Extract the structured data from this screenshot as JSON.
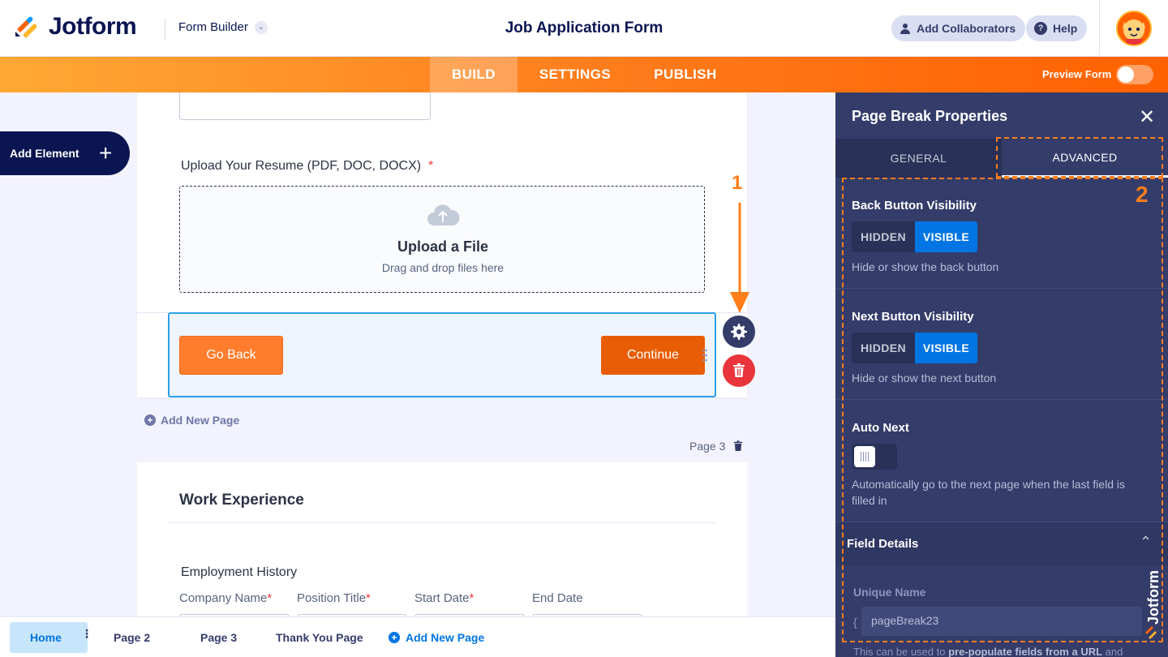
{
  "header": {
    "brand": "Jotform",
    "builder_label": "Form Builder",
    "form_title": "Job Application Form",
    "collaborators_label": "Add Collaborators",
    "help_label": "Help"
  },
  "nav": {
    "tabs": [
      "BUILD",
      "SETTINGS",
      "PUBLISH"
    ],
    "active": "BUILD",
    "preview_label": "Preview Form"
  },
  "sidebar": {
    "add_element_label": "Add Element"
  },
  "form": {
    "upload_field": {
      "label": "Upload Your Resume (PDF, DOC, DOCX)",
      "required_mark": "*",
      "title": "Upload a File",
      "subtitle": "Drag and drop files here"
    },
    "page_break": {
      "back_label": "Go Back",
      "continue_label": "Continue"
    },
    "add_new_page_label": "Add New Page",
    "page_label": "Page 3",
    "section_title": "Work Experience",
    "employment_label": "Employment History",
    "columns": [
      {
        "label": "Company Name",
        "required": "*"
      },
      {
        "label": "Position Title",
        "required": "*"
      },
      {
        "label": "Start Date",
        "required": "*"
      },
      {
        "label": "End Date",
        "required": ""
      }
    ]
  },
  "annotations": {
    "step1": "1",
    "step2": "2"
  },
  "pages_bar": {
    "tabs": [
      "Home",
      "Page 2",
      "Page 3",
      "Thank You Page"
    ],
    "active": "Home",
    "add_label": "Add New Page"
  },
  "panel": {
    "title": "Page Break Properties",
    "tabs": [
      "GENERAL",
      "ADVANCED"
    ],
    "active_tab": "ADVANCED",
    "back_visibility": {
      "label": "Back Button Visibility",
      "options": [
        "HIDDEN",
        "VISIBLE"
      ],
      "selected": "VISIBLE",
      "help": "Hide or show the back button"
    },
    "next_visibility": {
      "label": "Next Button Visibility",
      "options": [
        "HIDDEN",
        "VISIBLE"
      ],
      "selected": "VISIBLE",
      "help": "Hide or show the next button"
    },
    "auto_next": {
      "label": "Auto Next",
      "enabled": false,
      "help": "Automatically go to the next page when the last field is filled in"
    },
    "field_details": {
      "label": "Field Details",
      "unique_name_label": "Unique Name",
      "brace": "{",
      "unique_name_value": "pageBreak23",
      "help_prefix": "This can be used to ",
      "help_bold": "pre-populate fields from a URL",
      "help_suffix": " and"
    }
  },
  "colors": {
    "brand_navy": "#0a1551",
    "accent_orange": "#ff7d1a",
    "panel_bg": "#343c6a",
    "active_blue": "#0075e3",
    "delete_red": "#e8343a"
  },
  "icons": {
    "close": "close-icon",
    "gear": "gear-icon",
    "trash": "trash-icon",
    "upload": "cloud-upload-icon",
    "chevron_up": "chevron-up-icon"
  }
}
